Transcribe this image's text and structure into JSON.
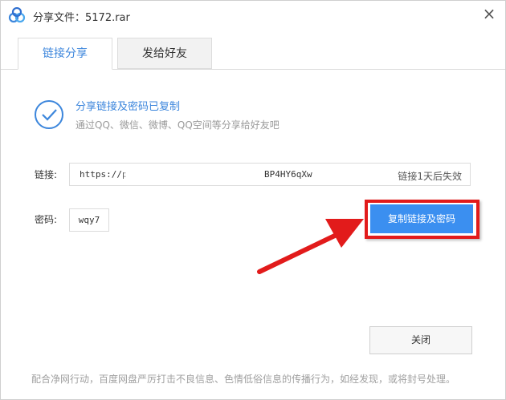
{
  "window": {
    "title": "分享文件：5172.rar",
    "close_symbol": "×"
  },
  "tabs": [
    {
      "label": "链接分享",
      "active": true
    },
    {
      "label": "发给好友",
      "active": false
    }
  ],
  "success": {
    "icon": "check-circle-icon",
    "title": "分享链接及密码已复制",
    "subtitle": "通过QQ、微信、微博、QQ空间等分享给好友吧"
  },
  "link": {
    "label": "链接:",
    "value": "https://p",
    "value_end": "BP4HY6qXw",
    "expire_text": "链接1天后失效"
  },
  "password": {
    "label": "密码:",
    "value": "wqy7"
  },
  "copy_button": {
    "label": "复制链接及密码"
  },
  "close_button": {
    "label": "关闭"
  },
  "footer": "配合净网行动，百度网盘严厉打击不良信息、色情低俗信息的传播行为，如经发现，或将封号处理。",
  "colors": {
    "accent": "#3c86dc",
    "button": "#3b8ff0",
    "highlight": "#e21b1b"
  }
}
